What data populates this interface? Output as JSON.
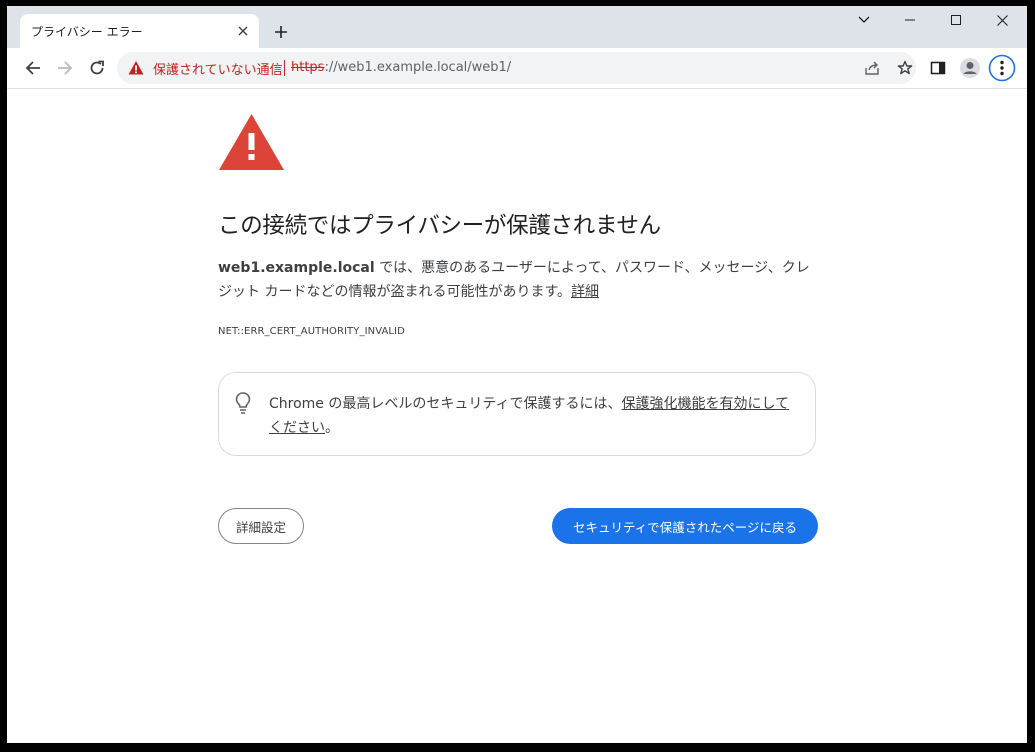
{
  "tab": {
    "title": "プライバシー エラー"
  },
  "omnibox": {
    "security_label": "保護されていない通信",
    "url_scheme": "https",
    "url_rest": "://web1.example.local/web1/"
  },
  "page": {
    "heading": "この接続ではプライバシーが保護されません",
    "host": "web1.example.local",
    "body_text": " では、悪意のあるユーザーによって、パスワード、メッセージ、クレジット カードなどの情報が盗まれる可能性があります。",
    "details_link": "詳細",
    "error_code": "NET::ERR_CERT_AUTHORITY_INVALID",
    "tip_text": "Chrome の最高レベルのセキュリティで保護するには、",
    "tip_link": "保護強化機能を有効にしてください",
    "tip_end": "。",
    "advanced_button": "詳細設定",
    "back_button": "セキュリティで保護されたページに戻る"
  },
  "colors": {
    "accent": "#1a73e8",
    "warning": "#c5221f",
    "warning_icon": "#db4437"
  }
}
